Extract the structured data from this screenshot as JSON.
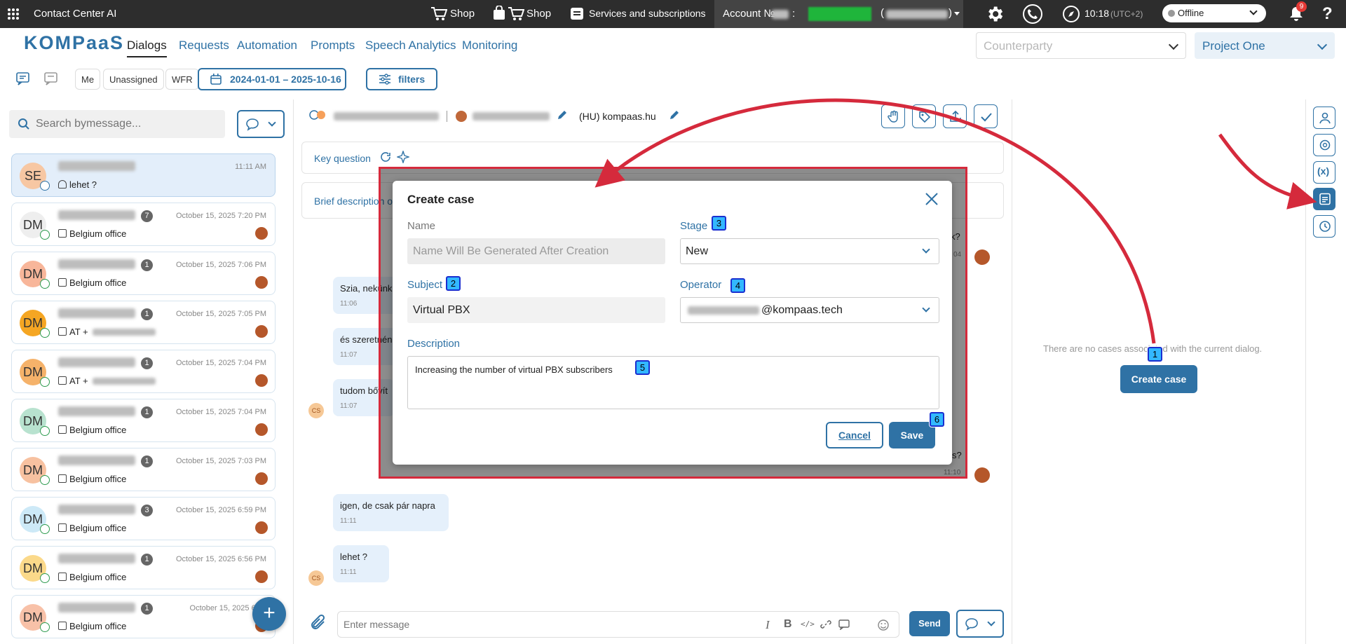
{
  "topbar": {
    "app_title": "Contact Center AI",
    "shop1": "Shop",
    "shop2": "Shop",
    "services": "Services and subscriptions",
    "account_label": "Account №",
    "account_colon": ":",
    "paren_open": "(",
    "paren_close": ")",
    "time": "10:18",
    "timezone": "(UTC+2)",
    "status": "Offline",
    "notif_count": "9",
    "help": "?"
  },
  "nav": {
    "logo": "KOMPaaS",
    "tabs": [
      "Dialogs",
      "Requests",
      "Automation",
      "Prompts",
      "Speech Analytics",
      "Monitoring"
    ],
    "counterparty_placeholder": "Counterparty",
    "project": "Project One"
  },
  "filters": {
    "me": "Me",
    "unassigned": "Unassigned",
    "wfr": "WFR",
    "date_range": "2024-01-01 – 2025-10-16",
    "filters_label": "filters"
  },
  "search": {
    "placeholder": "Search bymessage..."
  },
  "dialogs": [
    {
      "initials": "SE",
      "color": "#f7c7a3",
      "badge": "",
      "time": "11:11 AM",
      "sub": "lehet ?"
    },
    {
      "initials": "DM",
      "color": "#eeeeee",
      "badge": "7",
      "time": "October 15, 2025 7:20 PM",
      "sub": "Belgium office"
    },
    {
      "initials": "DM",
      "color": "#f8b69a",
      "badge": "1",
      "time": "October 15, 2025 7:06 PM",
      "sub": "Belgium office"
    },
    {
      "initials": "DM",
      "color": "#f5a623",
      "badge": "1",
      "time": "October 15, 2025 7:05 PM",
      "sub": "AT +"
    },
    {
      "initials": "DM",
      "color": "#f5b26a",
      "badge": "1",
      "time": "October 15, 2025 7:04 PM",
      "sub": "AT +"
    },
    {
      "initials": "DM",
      "color": "#b8e2cf",
      "badge": "1",
      "time": "October 15, 2025 7:04 PM",
      "sub": "Belgium office"
    },
    {
      "initials": "DM",
      "color": "#f7c1a0",
      "badge": "1",
      "time": "October 15, 2025 7:03 PM",
      "sub": "Belgium office"
    },
    {
      "initials": "DM",
      "color": "#cde9f7",
      "badge": "3",
      "time": "October 15, 2025 6:59 PM",
      "sub": "Belgium office"
    },
    {
      "initials": "DM",
      "color": "#fbd98a",
      "badge": "1",
      "time": "October 15, 2025 6:56 PM",
      "sub": "Belgium office"
    },
    {
      "initials": "DM",
      "color": "#f8c1a8",
      "badge": "1",
      "time": "October 15, 2025 6:55",
      "sub": "Belgium office"
    }
  ],
  "chat_header": {
    "name_suffix": "(HU) kompaas.hu"
  },
  "panels": {
    "key_question": "Key question",
    "brief": "Brief description o"
  },
  "messages": [
    {
      "text": "Szia, nekünk",
      "time": "11:06"
    },
    {
      "text": "és szeretnén",
      "time": "11:07"
    },
    {
      "text": "tudom bővít",
      "time": "11:07"
    },
    {
      "text": "igen, de csak pár napra",
      "time": "11:11"
    },
    {
      "text": "lehet ?",
      "time": "11:11"
    }
  ],
  "right_partial": {
    "msg1": "k?",
    "time1": "04",
    "msg2": "s?",
    "time2": "11:10"
  },
  "cs_initials": "CS",
  "composer": {
    "placeholder": "Enter message",
    "send": "Send"
  },
  "cases": {
    "empty": "There are no cases associated with the current dialog.",
    "create": "Create case"
  },
  "modal": {
    "title": "Create case",
    "name_label": "Name",
    "name_placeholder": "Name Will Be Generated After Creation",
    "stage_label": "Stage",
    "stage_value": "New",
    "subject_label": "Subject",
    "subject_value": "Virtual PBX",
    "operator_label": "Operator",
    "operator_domain": "@kompaas.tech",
    "description_label": "Description",
    "description_value": "Increasing the number of virtual PBX subscribers",
    "cancel": "Cancel",
    "save": "Save"
  },
  "markers": [
    "1",
    "2",
    "3",
    "4",
    "5",
    "6"
  ],
  "colors": {
    "accent": "#2f72a5",
    "annotation": "#d52a3c",
    "topbar": "#2d2d2d"
  }
}
